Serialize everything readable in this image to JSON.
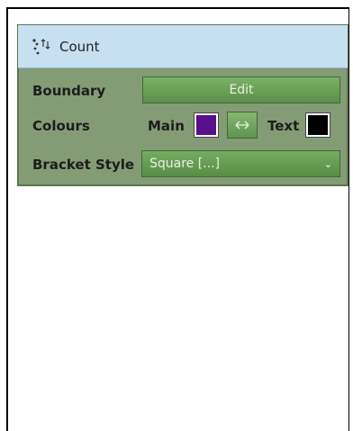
{
  "header": {
    "title": "Count",
    "icon": "count-dots-icon"
  },
  "rows": {
    "boundary_label": "Boundary",
    "edit_label": "Edit",
    "colours_label": "Colours",
    "main_label": "Main",
    "text_label": "Text",
    "bracket_label": "Bracket Style",
    "bracket_value": "Square [...]"
  },
  "colors": {
    "main": "#5a0f8c",
    "text": "#000000",
    "panel_bg": "#849c75",
    "header_bg": "#c6e0f2",
    "button_green": "#6aa058"
  },
  "icons": {
    "swap": "swap-arrows-icon",
    "dropdown": "chevron-down-icon"
  }
}
